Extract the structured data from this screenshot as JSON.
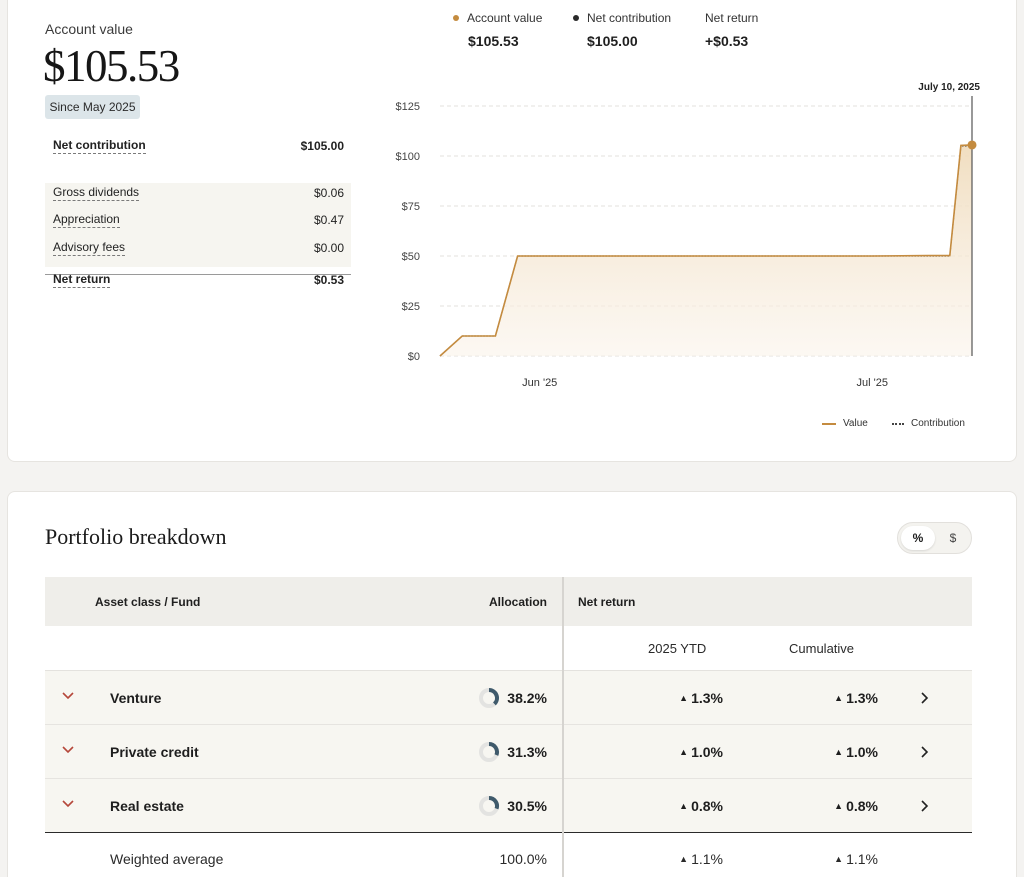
{
  "account": {
    "label": "Account value",
    "value": "$105.53",
    "since": "Since May 2025"
  },
  "summary": {
    "net_contribution": {
      "label": "Net contribution",
      "value": "$105.00"
    },
    "gross_dividends": {
      "label": "Gross dividends",
      "value": "$0.06"
    },
    "appreciation": {
      "label": "Appreciation",
      "value": "$0.47"
    },
    "advisory_fees": {
      "label": "Advisory fees",
      "value": "$0.00"
    },
    "net_return": {
      "label": "Net return",
      "value": "$0.53"
    }
  },
  "chart_header": {
    "account_value": {
      "label": "Account value",
      "value": "$105.53"
    },
    "net_contribution": {
      "label": "Net contribution",
      "value": "$105.00"
    },
    "net_return": {
      "label": "Net return",
      "value": "+$0.53"
    }
  },
  "colors": {
    "value_line": "#c48b3f",
    "contribution_line": "#555555",
    "accent_chevron": "#b5473a",
    "donut_fill": "#3f5a6b"
  },
  "chart_data": {
    "type": "area",
    "x_dates": [
      "2025-05-23",
      "2025-05-25",
      "2025-05-28",
      "2025-05-30",
      "2025-06-15",
      "2025-07-01",
      "2025-07-06",
      "2025-07-08",
      "2025-07-09",
      "2025-07-10"
    ],
    "series": [
      {
        "name": "Value",
        "values": [
          0,
          10,
          10,
          50,
          50,
          50,
          50.2,
          50.2,
          105.3,
          105.53
        ]
      },
      {
        "name": "Contribution",
        "values": [
          0,
          10,
          10,
          50,
          50,
          50,
          50,
          50,
          105,
          105
        ]
      }
    ],
    "x_ticks": [
      "Jun '25",
      "Jul '25"
    ],
    "y_ticks": [
      "$0",
      "$25",
      "$50",
      "$75",
      "$100",
      "$125"
    ],
    "ylim": [
      0,
      125
    ],
    "grid": true,
    "legend": "bottom-right",
    "marker_label": "July 10, 2025"
  },
  "portfolio": {
    "title": "Portfolio breakdown",
    "toggle": {
      "percent": "%",
      "dollar": "$"
    },
    "headers": {
      "asset": "Asset class / Fund",
      "allocation": "Allocation",
      "net_return": "Net return",
      "ytd": "2025 YTD",
      "cumulative": "Cumulative"
    },
    "rows": [
      {
        "name": "Venture",
        "allocation": "38.2%",
        "allocation_fraction": 0.382,
        "ytd": "1.3%",
        "cumulative": "1.3%"
      },
      {
        "name": "Private credit",
        "allocation": "31.3%",
        "allocation_fraction": 0.313,
        "ytd": "1.0%",
        "cumulative": "1.0%"
      },
      {
        "name": "Real estate",
        "allocation": "30.5%",
        "allocation_fraction": 0.305,
        "ytd": "0.8%",
        "cumulative": "0.8%"
      }
    ],
    "weighted": {
      "name": "Weighted average",
      "allocation": "100.0%",
      "ytd": "1.1%",
      "cumulative": "1.1%"
    }
  },
  "icons": {
    "up_triangle": "▲"
  }
}
